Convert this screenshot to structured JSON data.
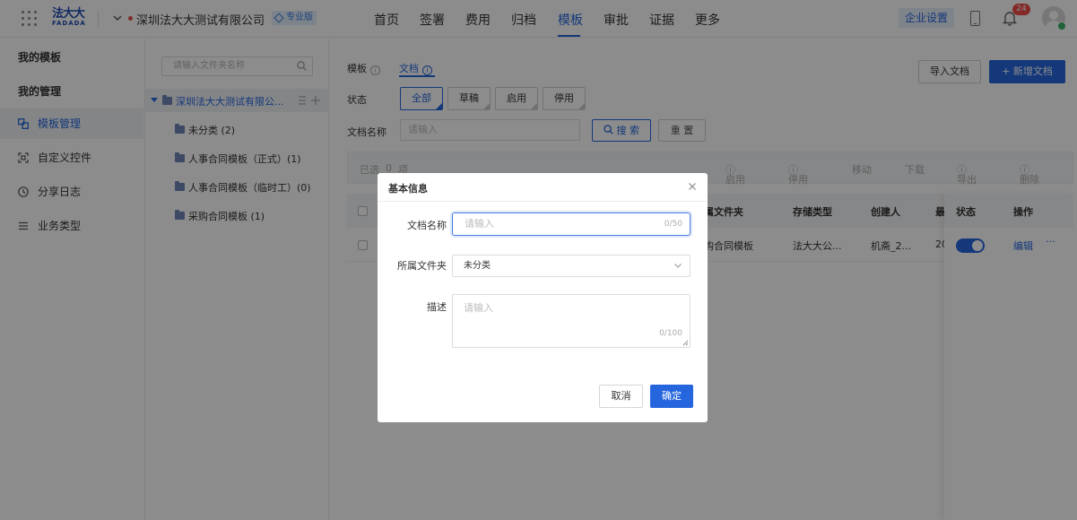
{
  "header": {
    "logo_cn": "法大大",
    "logo_en": "FADADA",
    "company": "深圳法大大测试有限公司（...",
    "badge": "专业版",
    "nav": [
      "首页",
      "签署",
      "费用",
      "归档",
      "模板",
      "审批",
      "证据",
      "更多"
    ],
    "active_nav": "模板",
    "enterprise_settings": "企业设置",
    "notification_count": "24"
  },
  "sidebar": {
    "my_templates": "我的模板",
    "my_management": "我的管理",
    "items": [
      {
        "label": "模板管理",
        "icon": "template-icon",
        "active": true
      },
      {
        "label": "自定义控件",
        "icon": "custom-control-icon",
        "active": false
      },
      {
        "label": "分享日志",
        "icon": "clock-icon",
        "active": false
      },
      {
        "label": "业务类型",
        "icon": "list-icon",
        "active": false
      }
    ]
  },
  "folders": {
    "search_placeholder": "请输入文件夹名称",
    "root": "深圳法大大测试有限公...",
    "items": [
      {
        "label": "未分类 (2)"
      },
      {
        "label": "人事合同模板（正式）(1)"
      },
      {
        "label": "人事合同模板（临时工）(0)"
      },
      {
        "label": "采购合同模板 (1)"
      }
    ]
  },
  "main": {
    "tabs": [
      {
        "label": "模板",
        "active": false
      },
      {
        "label": "文档",
        "active": true
      }
    ],
    "import_btn": "导入文档",
    "new_btn": "新增文档",
    "status_label": "状态",
    "status_options": [
      "全部",
      "草稿",
      "启用",
      "停用"
    ],
    "doc_name_label": "文档名称",
    "doc_name_placeholder": "请输入",
    "search_btn": "搜 索",
    "reset_btn": "重 置",
    "selection_bar": {
      "selected": "已选",
      "count": "0",
      "unit": "项",
      "actions": [
        "启用",
        "停用",
        "移动",
        "下载",
        "导出",
        "删除"
      ]
    },
    "table": {
      "headers": [
        "属文件夹",
        "存储类型",
        "创建人",
        "最"
      ],
      "fixed_headers": [
        "状态",
        "操作"
      ],
      "row": {
        "folder": "购合同模板",
        "storage": "法大大公...",
        "creator": "机斋_2...",
        "date_partial": "20"
      },
      "edit": "编辑",
      "more": "···"
    }
  },
  "modal": {
    "title": "基本信息",
    "doc_name_label": "文档名称",
    "doc_name_placeholder": "请输入",
    "doc_name_count": "0/50",
    "folder_label": "所属文件夹",
    "folder_value": "未分类",
    "desc_label": "描述",
    "desc_placeholder": "请输入",
    "desc_count": "0/100",
    "cancel": "取消",
    "confirm": "确定"
  },
  "colors": {
    "primary": "#2566de",
    "badge_bg": "#e3eefc",
    "danger": "#f04a4a",
    "online": "#3bb36a"
  }
}
